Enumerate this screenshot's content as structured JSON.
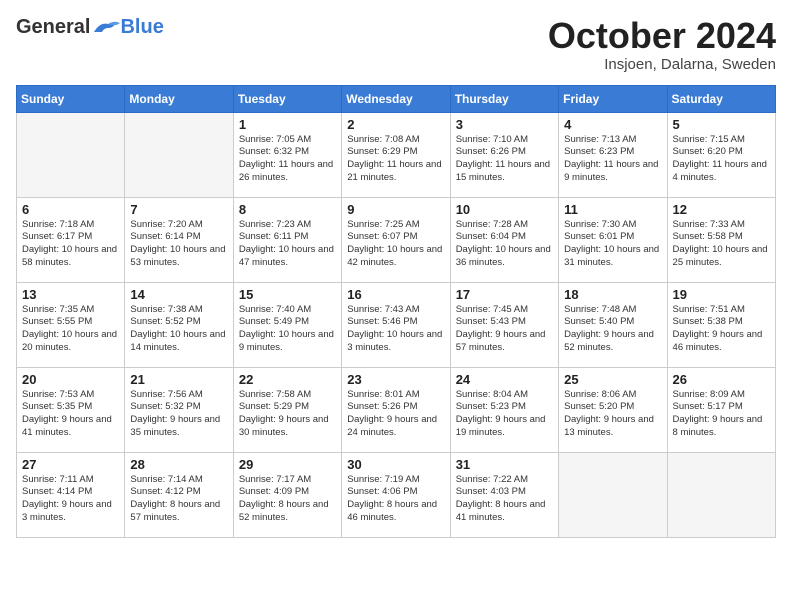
{
  "header": {
    "logo_general": "General",
    "logo_blue": "Blue",
    "month_title": "October 2024",
    "subtitle": "Insjoen, Dalarna, Sweden"
  },
  "weekdays": [
    "Sunday",
    "Monday",
    "Tuesday",
    "Wednesday",
    "Thursday",
    "Friday",
    "Saturday"
  ],
  "weeks": [
    [
      {
        "day": "",
        "sunrise": "",
        "sunset": "",
        "daylight": "",
        "empty": true
      },
      {
        "day": "",
        "sunrise": "",
        "sunset": "",
        "daylight": "",
        "empty": true
      },
      {
        "day": "1",
        "sunrise": "Sunrise: 7:05 AM",
        "sunset": "Sunset: 6:32 PM",
        "daylight": "Daylight: 11 hours and 26 minutes.",
        "empty": false
      },
      {
        "day": "2",
        "sunrise": "Sunrise: 7:08 AM",
        "sunset": "Sunset: 6:29 PM",
        "daylight": "Daylight: 11 hours and 21 minutes.",
        "empty": false
      },
      {
        "day": "3",
        "sunrise": "Sunrise: 7:10 AM",
        "sunset": "Sunset: 6:26 PM",
        "daylight": "Daylight: 11 hours and 15 minutes.",
        "empty": false
      },
      {
        "day": "4",
        "sunrise": "Sunrise: 7:13 AM",
        "sunset": "Sunset: 6:23 PM",
        "daylight": "Daylight: 11 hours and 9 minutes.",
        "empty": false
      },
      {
        "day": "5",
        "sunrise": "Sunrise: 7:15 AM",
        "sunset": "Sunset: 6:20 PM",
        "daylight": "Daylight: 11 hours and 4 minutes.",
        "empty": false
      }
    ],
    [
      {
        "day": "6",
        "sunrise": "Sunrise: 7:18 AM",
        "sunset": "Sunset: 6:17 PM",
        "daylight": "Daylight: 10 hours and 58 minutes.",
        "empty": false
      },
      {
        "day": "7",
        "sunrise": "Sunrise: 7:20 AM",
        "sunset": "Sunset: 6:14 PM",
        "daylight": "Daylight: 10 hours and 53 minutes.",
        "empty": false
      },
      {
        "day": "8",
        "sunrise": "Sunrise: 7:23 AM",
        "sunset": "Sunset: 6:11 PM",
        "daylight": "Daylight: 10 hours and 47 minutes.",
        "empty": false
      },
      {
        "day": "9",
        "sunrise": "Sunrise: 7:25 AM",
        "sunset": "Sunset: 6:07 PM",
        "daylight": "Daylight: 10 hours and 42 minutes.",
        "empty": false
      },
      {
        "day": "10",
        "sunrise": "Sunrise: 7:28 AM",
        "sunset": "Sunset: 6:04 PM",
        "daylight": "Daylight: 10 hours and 36 minutes.",
        "empty": false
      },
      {
        "day": "11",
        "sunrise": "Sunrise: 7:30 AM",
        "sunset": "Sunset: 6:01 PM",
        "daylight": "Daylight: 10 hours and 31 minutes.",
        "empty": false
      },
      {
        "day": "12",
        "sunrise": "Sunrise: 7:33 AM",
        "sunset": "Sunset: 5:58 PM",
        "daylight": "Daylight: 10 hours and 25 minutes.",
        "empty": false
      }
    ],
    [
      {
        "day": "13",
        "sunrise": "Sunrise: 7:35 AM",
        "sunset": "Sunset: 5:55 PM",
        "daylight": "Daylight: 10 hours and 20 minutes.",
        "empty": false
      },
      {
        "day": "14",
        "sunrise": "Sunrise: 7:38 AM",
        "sunset": "Sunset: 5:52 PM",
        "daylight": "Daylight: 10 hours and 14 minutes.",
        "empty": false
      },
      {
        "day": "15",
        "sunrise": "Sunrise: 7:40 AM",
        "sunset": "Sunset: 5:49 PM",
        "daylight": "Daylight: 10 hours and 9 minutes.",
        "empty": false
      },
      {
        "day": "16",
        "sunrise": "Sunrise: 7:43 AM",
        "sunset": "Sunset: 5:46 PM",
        "daylight": "Daylight: 10 hours and 3 minutes.",
        "empty": false
      },
      {
        "day": "17",
        "sunrise": "Sunrise: 7:45 AM",
        "sunset": "Sunset: 5:43 PM",
        "daylight": "Daylight: 9 hours and 57 minutes.",
        "empty": false
      },
      {
        "day": "18",
        "sunrise": "Sunrise: 7:48 AM",
        "sunset": "Sunset: 5:40 PM",
        "daylight": "Daylight: 9 hours and 52 minutes.",
        "empty": false
      },
      {
        "day": "19",
        "sunrise": "Sunrise: 7:51 AM",
        "sunset": "Sunset: 5:38 PM",
        "daylight": "Daylight: 9 hours and 46 minutes.",
        "empty": false
      }
    ],
    [
      {
        "day": "20",
        "sunrise": "Sunrise: 7:53 AM",
        "sunset": "Sunset: 5:35 PM",
        "daylight": "Daylight: 9 hours and 41 minutes.",
        "empty": false
      },
      {
        "day": "21",
        "sunrise": "Sunrise: 7:56 AM",
        "sunset": "Sunset: 5:32 PM",
        "daylight": "Daylight: 9 hours and 35 minutes.",
        "empty": false
      },
      {
        "day": "22",
        "sunrise": "Sunrise: 7:58 AM",
        "sunset": "Sunset: 5:29 PM",
        "daylight": "Daylight: 9 hours and 30 minutes.",
        "empty": false
      },
      {
        "day": "23",
        "sunrise": "Sunrise: 8:01 AM",
        "sunset": "Sunset: 5:26 PM",
        "daylight": "Daylight: 9 hours and 24 minutes.",
        "empty": false
      },
      {
        "day": "24",
        "sunrise": "Sunrise: 8:04 AM",
        "sunset": "Sunset: 5:23 PM",
        "daylight": "Daylight: 9 hours and 19 minutes.",
        "empty": false
      },
      {
        "day": "25",
        "sunrise": "Sunrise: 8:06 AM",
        "sunset": "Sunset: 5:20 PM",
        "daylight": "Daylight: 9 hours and 13 minutes.",
        "empty": false
      },
      {
        "day": "26",
        "sunrise": "Sunrise: 8:09 AM",
        "sunset": "Sunset: 5:17 PM",
        "daylight": "Daylight: 9 hours and 8 minutes.",
        "empty": false
      }
    ],
    [
      {
        "day": "27",
        "sunrise": "Sunrise: 7:11 AM",
        "sunset": "Sunset: 4:14 PM",
        "daylight": "Daylight: 9 hours and 3 minutes.",
        "empty": false
      },
      {
        "day": "28",
        "sunrise": "Sunrise: 7:14 AM",
        "sunset": "Sunset: 4:12 PM",
        "daylight": "Daylight: 8 hours and 57 minutes.",
        "empty": false
      },
      {
        "day": "29",
        "sunrise": "Sunrise: 7:17 AM",
        "sunset": "Sunset: 4:09 PM",
        "daylight": "Daylight: 8 hours and 52 minutes.",
        "empty": false
      },
      {
        "day": "30",
        "sunrise": "Sunrise: 7:19 AM",
        "sunset": "Sunset: 4:06 PM",
        "daylight": "Daylight: 8 hours and 46 minutes.",
        "empty": false
      },
      {
        "day": "31",
        "sunrise": "Sunrise: 7:22 AM",
        "sunset": "Sunset: 4:03 PM",
        "daylight": "Daylight: 8 hours and 41 minutes.",
        "empty": false
      },
      {
        "day": "",
        "sunrise": "",
        "sunset": "",
        "daylight": "",
        "empty": true
      },
      {
        "day": "",
        "sunrise": "",
        "sunset": "",
        "daylight": "",
        "empty": true
      }
    ]
  ]
}
